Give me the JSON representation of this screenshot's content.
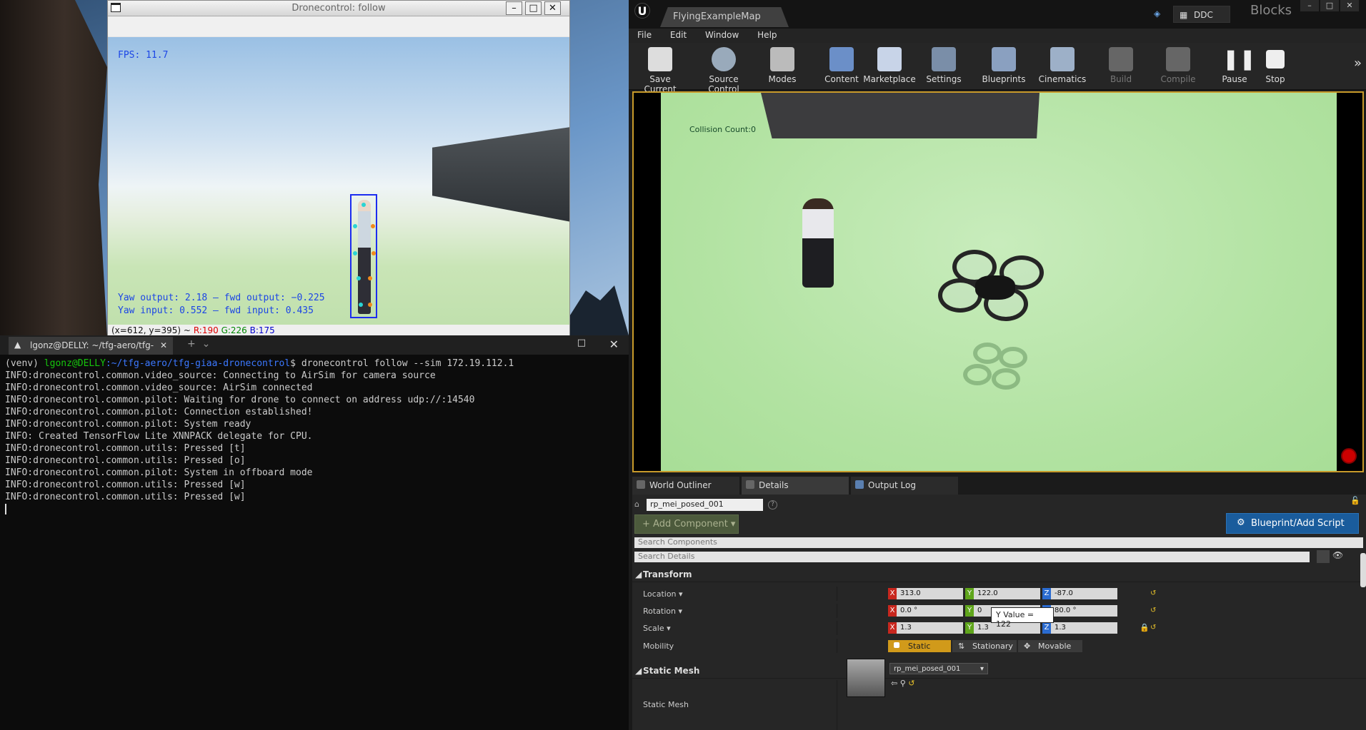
{
  "follow_window": {
    "title": "Dronecontrol: follow",
    "fps": "FPS: 11.7",
    "yaw_output": "Yaw output: 2.18 — fwd output: −0.225",
    "yaw_input": "Yaw input: 0.552 — fwd input: 0.435",
    "status_coords": "(x=612, y=395) ~",
    "status_r": "R:190",
    "status_g": "G:226",
    "status_b": "B:175"
  },
  "terminal": {
    "tab_title": "lgonz@DELLY: ~/tfg-aero/tfg-",
    "prompt_venv": "(venv) ",
    "prompt_user": "lgonz@DELLY",
    "prompt_path": ":~/tfg-aero/tfg-giaa-dronecontrol",
    "command": "$ dronecontrol follow --sim 172.19.112.1",
    "lines": [
      "INFO:dronecontrol.common.video_source: Connecting to AirSim for camera source",
      "INFO:dronecontrol.common.video_source: AirSim connected",
      "INFO:dronecontrol.common.pilot: Waiting for drone to connect on address udp://:14540",
      "INFO:dronecontrol.common.pilot: Connection established!",
      "INFO:dronecontrol.common.pilot: System ready",
      "INFO: Created TensorFlow Lite XNNPACK delegate for CPU.",
      "INFO:dronecontrol.common.utils: Pressed [t]",
      "INFO:dronecontrol.common.utils: Pressed [o]",
      "INFO:dronecontrol.common.pilot: System in offboard mode",
      "INFO:dronecontrol.common.utils: Pressed [w]",
      "INFO:dronecontrol.common.utils: Pressed [w]"
    ]
  },
  "unreal": {
    "map_tab": "FlyingExampleMap",
    "ddc": "DDC",
    "project": "Blocks",
    "menu": [
      "File",
      "Edit",
      "Window",
      "Help"
    ],
    "tools": {
      "save": "Save Current",
      "source": "Source Control",
      "modes": "Modes",
      "content": "Content",
      "marketplace": "Marketplace",
      "settings": "Settings",
      "blueprints": "Blueprints",
      "cinematics": "Cinematics",
      "build": "Build",
      "compile": "Compile",
      "pause": "Pause",
      "stop": "Stop"
    },
    "collision": "Collision Count:0",
    "panel_tabs": [
      "World Outliner",
      "Details",
      "Output Log"
    ],
    "actor_name": "rp_mei_posed_001",
    "add_component": "+ Add Component ▾",
    "blueprint_btn": "Blueprint/Add Script",
    "search_components": "Search Components",
    "search_details": "Search Details",
    "transform": {
      "header": "Transform",
      "location_label": "Location ▾",
      "rotation_label": "Rotation ▾",
      "scale_label": "Scale ▾",
      "mobility_label": "Mobility",
      "location": [
        "313.0",
        "122.0",
        "-87.0"
      ],
      "rotation": [
        "0.0 °",
        "0",
        "80.0 °"
      ],
      "scale": [
        "1.3",
        "1.3",
        "1.3"
      ],
      "tooltip": "Y Value = 122",
      "mobility": [
        "Static",
        "Stationary",
        "Movable"
      ]
    },
    "static_mesh": {
      "header": "Static Mesh",
      "label": "Static Mesh",
      "value": "rp_mei_posed_001"
    }
  }
}
